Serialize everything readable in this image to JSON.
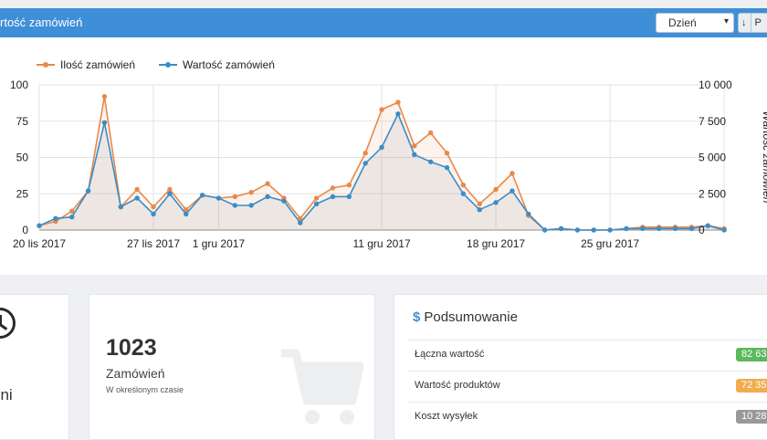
{
  "header": {
    "title": "rtość zamówień",
    "period_select_value": "Dzień",
    "export_label": "P"
  },
  "legend": {
    "series1": "Ilość zamówień",
    "series2": "Wartość zamówień"
  },
  "chart_data": {
    "type": "line",
    "title": "",
    "x_tick_labels": [
      "20 lis 2017",
      "27 lis 2017",
      "1 gru 2017",
      "11 gru 2017",
      "18 gru 2017",
      "25 gru 2017"
    ],
    "x_tick_days": [
      0,
      7,
      11,
      21,
      28,
      35
    ],
    "left_axis": {
      "ticks": [
        "0",
        "25",
        "50",
        "75",
        "100"
      ],
      "ylim": [
        0,
        100
      ]
    },
    "right_axis": {
      "label": "Wartość zamówień",
      "ticks": [
        "0",
        "2 500",
        "5 000",
        "7 500",
        "10 000"
      ],
      "ylim": [
        0,
        10000
      ]
    },
    "series": [
      {
        "name": "Ilość zamówień",
        "color": "#e8894a",
        "axis": "left",
        "values": [
          3,
          6,
          13,
          27,
          92,
          16,
          28,
          16,
          28,
          14,
          24,
          22,
          23,
          26,
          32,
          22,
          8,
          22,
          29,
          31,
          53,
          83,
          88,
          58,
          67,
          53,
          31,
          18,
          28,
          39,
          10,
          0,
          1,
          0,
          0,
          0,
          1,
          2,
          2,
          2,
          2,
          3,
          1
        ]
      },
      {
        "name": "Wartość zamówień",
        "color": "#3a8dc8",
        "axis": "right",
        "values": [
          300,
          800,
          900,
          2700,
          7400,
          1600,
          2200,
          1100,
          2500,
          1100,
          2400,
          2200,
          1700,
          1700,
          2300,
          2000,
          500,
          1800,
          2300,
          2300,
          4600,
          5700,
          8000,
          5200,
          4700,
          4300,
          2500,
          1400,
          1900,
          2700,
          1100,
          0,
          100,
          0,
          0,
          0,
          100,
          100,
          100,
          100,
          100,
          300,
          0
        ]
      }
    ],
    "grid": true,
    "legend_position": "top-left"
  },
  "cards": {
    "left_text": "dni",
    "orders_value": "1023",
    "orders_label": "Zamówień",
    "orders_sub": "W określonym czasie"
  },
  "summary": {
    "title": "Podsumowanie",
    "rows": [
      {
        "label": "Łączna wartość",
        "value": "82 63",
        "color": "#5cb85c"
      },
      {
        "label": "Wartość produktów",
        "value": "72 35",
        "color": "#f0ad4e"
      },
      {
        "label": "Koszt wysyłek",
        "value": "10 28",
        "color": "#999999"
      }
    ]
  }
}
